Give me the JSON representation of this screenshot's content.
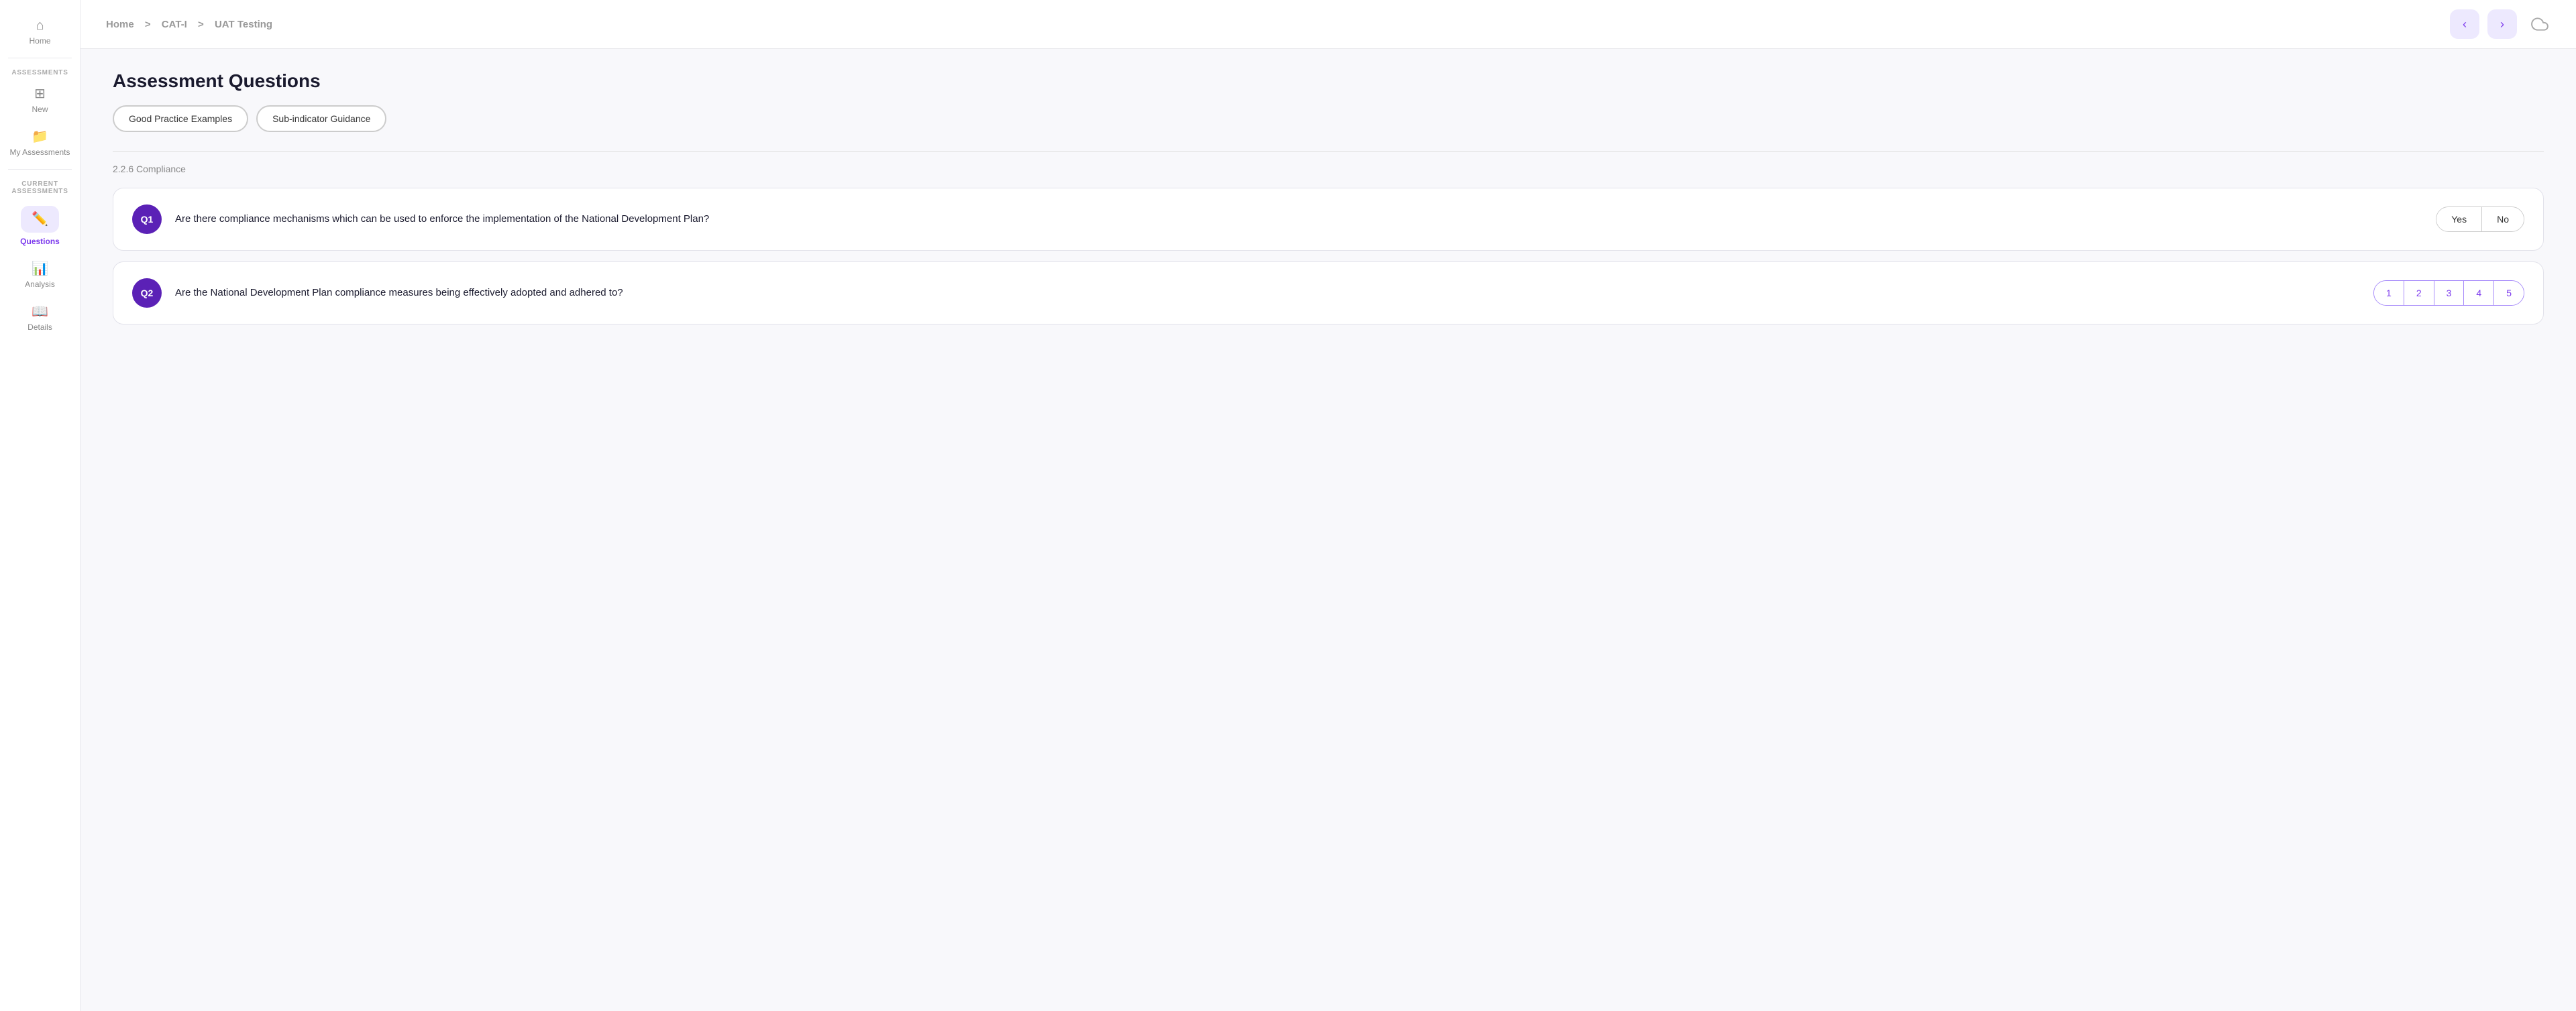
{
  "sidebar": {
    "home_label": "Home",
    "assessments_section": "ASSESSMENTS",
    "new_label": "New",
    "my_assessments_label": "My Assessments",
    "current_section": "CURRENT ASSESSMENTS",
    "questions_label": "Questions",
    "analysis_label": "Analysis",
    "details_label": "Details"
  },
  "topbar": {
    "breadcrumb_home": "Home",
    "breadcrumb_sep1": ">",
    "breadcrumb_cat": "CAT-I",
    "breadcrumb_sep2": ">",
    "breadcrumb_page": "UAT Testing"
  },
  "content": {
    "page_title": "Assessment Questions",
    "btn_good_practice": "Good Practice Examples",
    "btn_sub_indicator": "Sub-indicator Guidance",
    "section_label": "2.2.6 Compliance",
    "questions": [
      {
        "id": "Q1",
        "text": "Are there compliance mechanisms which can be used to enforce the implementation of the National Development Plan?",
        "type": "yes_no",
        "yes_label": "Yes",
        "no_label": "No"
      },
      {
        "id": "Q2",
        "text": "Are the National Development Plan compliance measures being effectively adopted and adhered to?",
        "type": "scale",
        "scale": [
          "1",
          "2",
          "3",
          "4",
          "5"
        ]
      }
    ]
  }
}
